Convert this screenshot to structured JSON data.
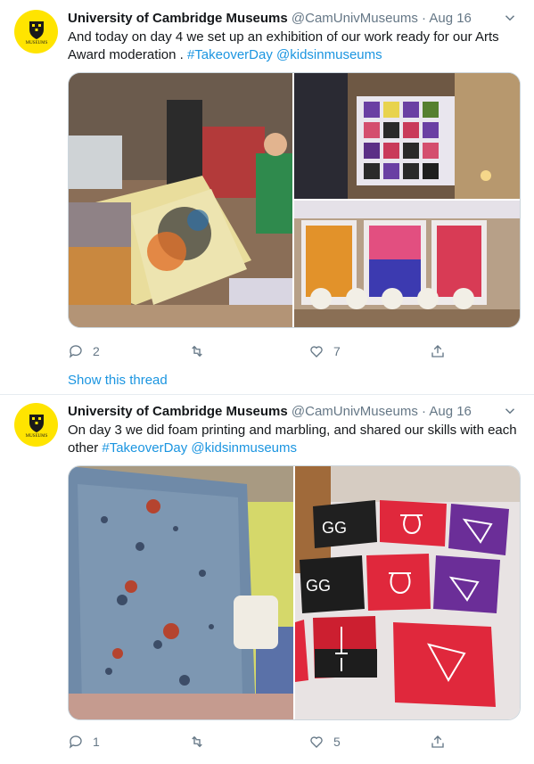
{
  "tweets": [
    {
      "name": "University of Cambridge Museums",
      "handle": "@CamUnivMuseums",
      "separator": "·",
      "date": "Aug 16",
      "text_plain": "And today on day 4 we set up an exhibition of our work ready for our Arts Award moderation . ",
      "hashtag": "#TakeoverDay",
      "mention": "@kidsinmuseums",
      "replies": "2",
      "likes": "7",
      "show_thread": "Show this thread"
    },
    {
      "name": "University of Cambridge Museums",
      "handle": "@CamUnivMuseums",
      "separator": "·",
      "date": "Aug 16",
      "text_plain": "On day 3 we did foam printing and marbling, and shared our skills with each other ",
      "hashtag": "#TakeoverDay",
      "mention": "@kidsinmuseums",
      "replies": "1",
      "likes": "5"
    }
  ],
  "avatar_text": "MUSEUMS",
  "colors": {
    "link": "#1b95e0",
    "muted": "#657786",
    "avatar_bg": "#ffe400"
  }
}
